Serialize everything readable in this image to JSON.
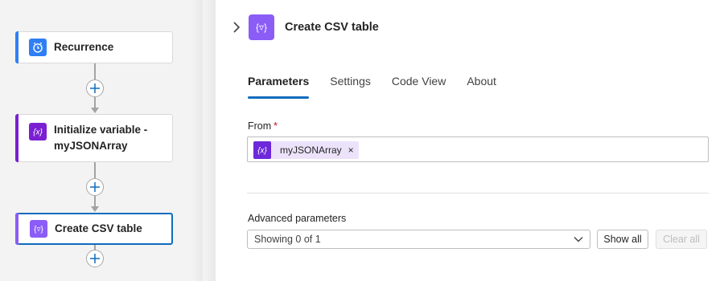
{
  "workflow": {
    "nodes": [
      {
        "title": "Recurrence",
        "icon": "clock-icon",
        "accent": "#2f7ff4"
      },
      {
        "title": "Initialize variable - myJSONArray",
        "icon": "variable-icon",
        "accent": "#7a1fd2"
      },
      {
        "title": "Create CSV table",
        "icon": "data-operation-icon",
        "accent": "#8b5cf6"
      }
    ]
  },
  "panel": {
    "title": "Create CSV table",
    "header_icon": "data-operation-icon",
    "tabs": [
      "Parameters",
      "Settings",
      "Code View",
      "About"
    ],
    "active_tab": "Parameters",
    "from_label": "From",
    "required_marker": "*",
    "from_token": {
      "text": "myJSONArray",
      "remove": "×",
      "icon": "variable-icon"
    },
    "advanced_label": "Advanced parameters",
    "advanced_select": "Showing 0 of 1",
    "show_all": "Show all",
    "clear_all": "Clear all"
  },
  "colors": {
    "primary": "#0f6cbd",
    "recurrence": "#2f7ff4",
    "variable": "#7a1fd2",
    "data_operation": "#8b5cf6",
    "required": "#c50f1f"
  }
}
